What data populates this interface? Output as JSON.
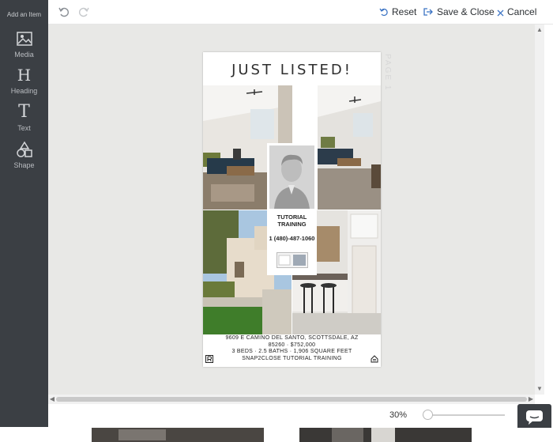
{
  "sidebar": {
    "header": "Add an Item",
    "tools": [
      {
        "label": "Media",
        "icon": "image-icon"
      },
      {
        "label": "Heading",
        "icon": "heading-icon"
      },
      {
        "label": "Text",
        "icon": "text-icon"
      },
      {
        "label": "Shape",
        "icon": "shape-icon"
      }
    ]
  },
  "toolbar": {
    "reset_label": "Reset",
    "save_close_label": "Save & Close",
    "cancel_label": "Cancel"
  },
  "flyer": {
    "headline": "JUST LISTED!",
    "page_tag": "PAGE 1",
    "agent_name": "TUTORIAL TRAINING",
    "agent_phone": "1 (480)-487-1060",
    "address_line": "9609 E CAMINO DEL SANTO, SCOTTSDALE, AZ",
    "zip_price": "85260 · $752,000",
    "specs": "3 BEDS · 2.5 BATHS · 1,906 SQUARE FEET",
    "brokerage": "SNAP2CLOSE TUTORIAL TRAINING"
  },
  "zoom": {
    "label": "30%",
    "level_percent": 30
  },
  "colors": {
    "sidebar_bg": "#3b3f44",
    "canvas_bg": "#e8e8e6",
    "accent": "#3b73c4"
  }
}
